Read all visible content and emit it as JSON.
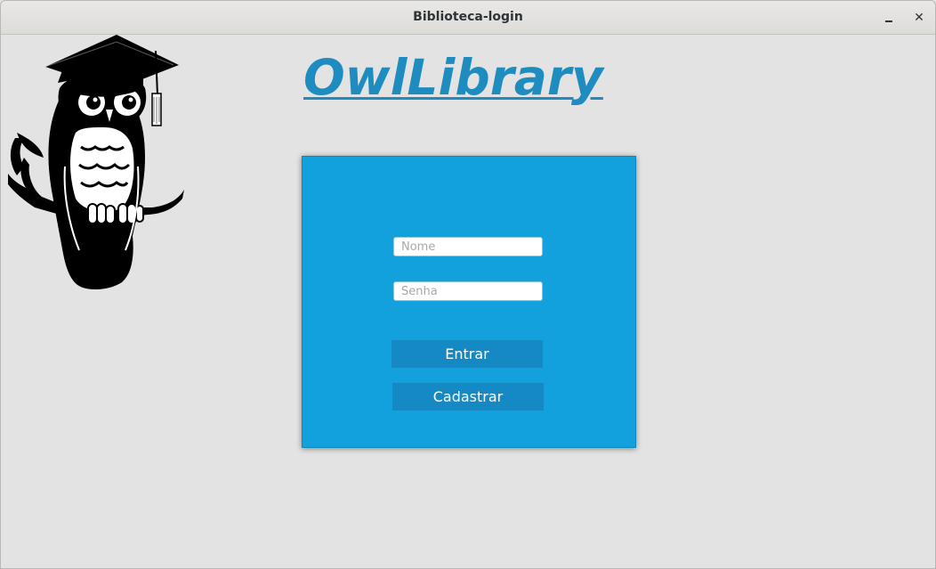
{
  "window": {
    "title": "Biblioteca-login",
    "minimize_label": "–",
    "close_label": "✕"
  },
  "header": {
    "logo_text": "OwlLibrary",
    "logo_color": "#1f8cc0",
    "mascot_icon": "graduate-owl-icon"
  },
  "login": {
    "panel_color": "#12a1dc",
    "name_placeholder": "Nome",
    "name_value": "",
    "password_placeholder": "Senha",
    "password_value": "",
    "enter_label": "Entrar",
    "register_label": "Cadastrar",
    "button_color": "#1589c4"
  }
}
